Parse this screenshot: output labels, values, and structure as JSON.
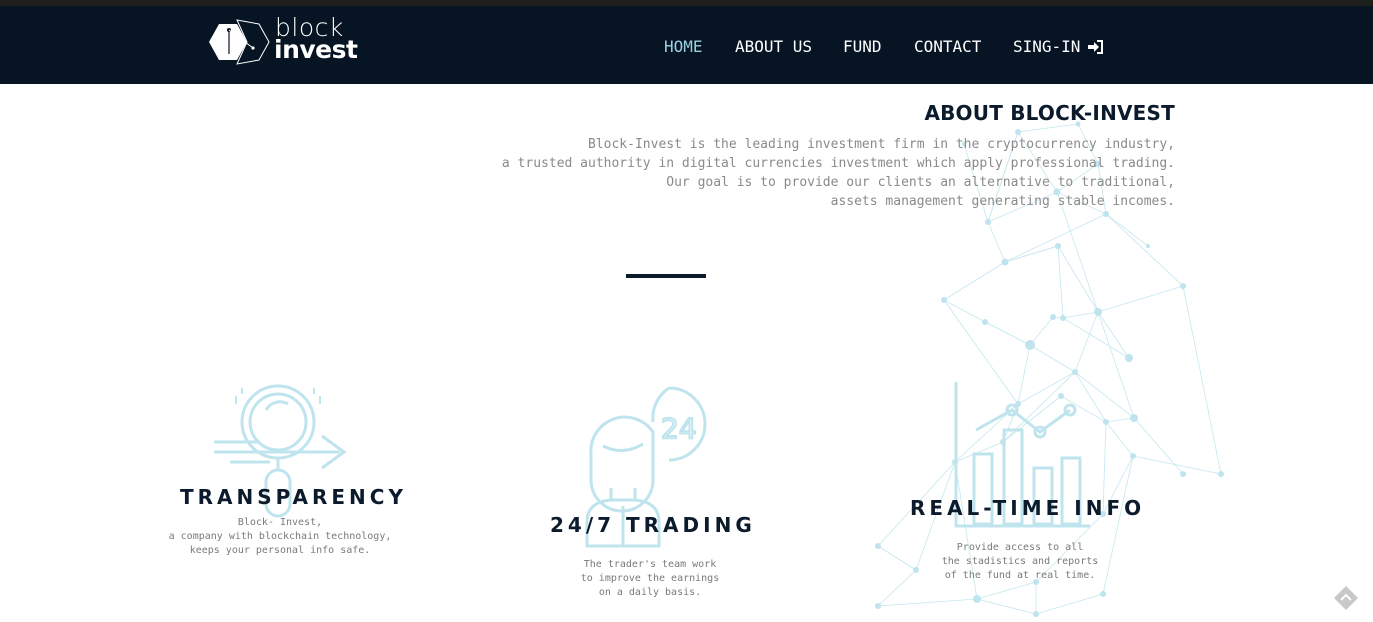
{
  "logo": {
    "text_top": "block",
    "text_bottom": "invest"
  },
  "nav": {
    "items": [
      {
        "label": "HOME",
        "active": true
      },
      {
        "label": "ABOUT US",
        "active": false
      },
      {
        "label": "FUND",
        "active": false
      },
      {
        "label": "CONTACT",
        "active": false
      },
      {
        "label": "SING-IN",
        "active": false,
        "icon": "sign-in-icon"
      }
    ]
  },
  "about": {
    "title": "ABOUT BLOCK-INVEST",
    "lines": [
      "Block-Invest is the leading investment firm in the cryptocurrency industry,",
      "a trusted authority in digital currencies investment which apply professional trading.",
      "Our goal is to provide our clients an alternative to traditional,",
      "assets management generating stable incomes."
    ]
  },
  "features": [
    {
      "title": "TRANSPARENCY",
      "icon": "magnifier-arrow-icon",
      "lines": [
        "Block- Invest,",
        "a company with blockchain technology,",
        "keeps your personal info safe."
      ]
    },
    {
      "title": "24/7 TRADING",
      "icon": "trader-24-icon",
      "lines": [
        "The trader's team work",
        "to improve the earnings",
        "on a daily basis."
      ]
    },
    {
      "title": "REAL-TIME INFO",
      "icon": "bar-chart-icon",
      "lines": [
        "Provide access to all",
        "the stadistics and reports",
        "of the fund at real time."
      ]
    }
  ],
  "colors": {
    "navbar_bg": "#071423",
    "accent": "#9ad1e0",
    "heading": "#0c1b2c",
    "body_text": "#8a8a8a"
  },
  "decor": {
    "background_icon": "blockchain-network-graphic",
    "corner_icon": "scroll-top-icon"
  }
}
